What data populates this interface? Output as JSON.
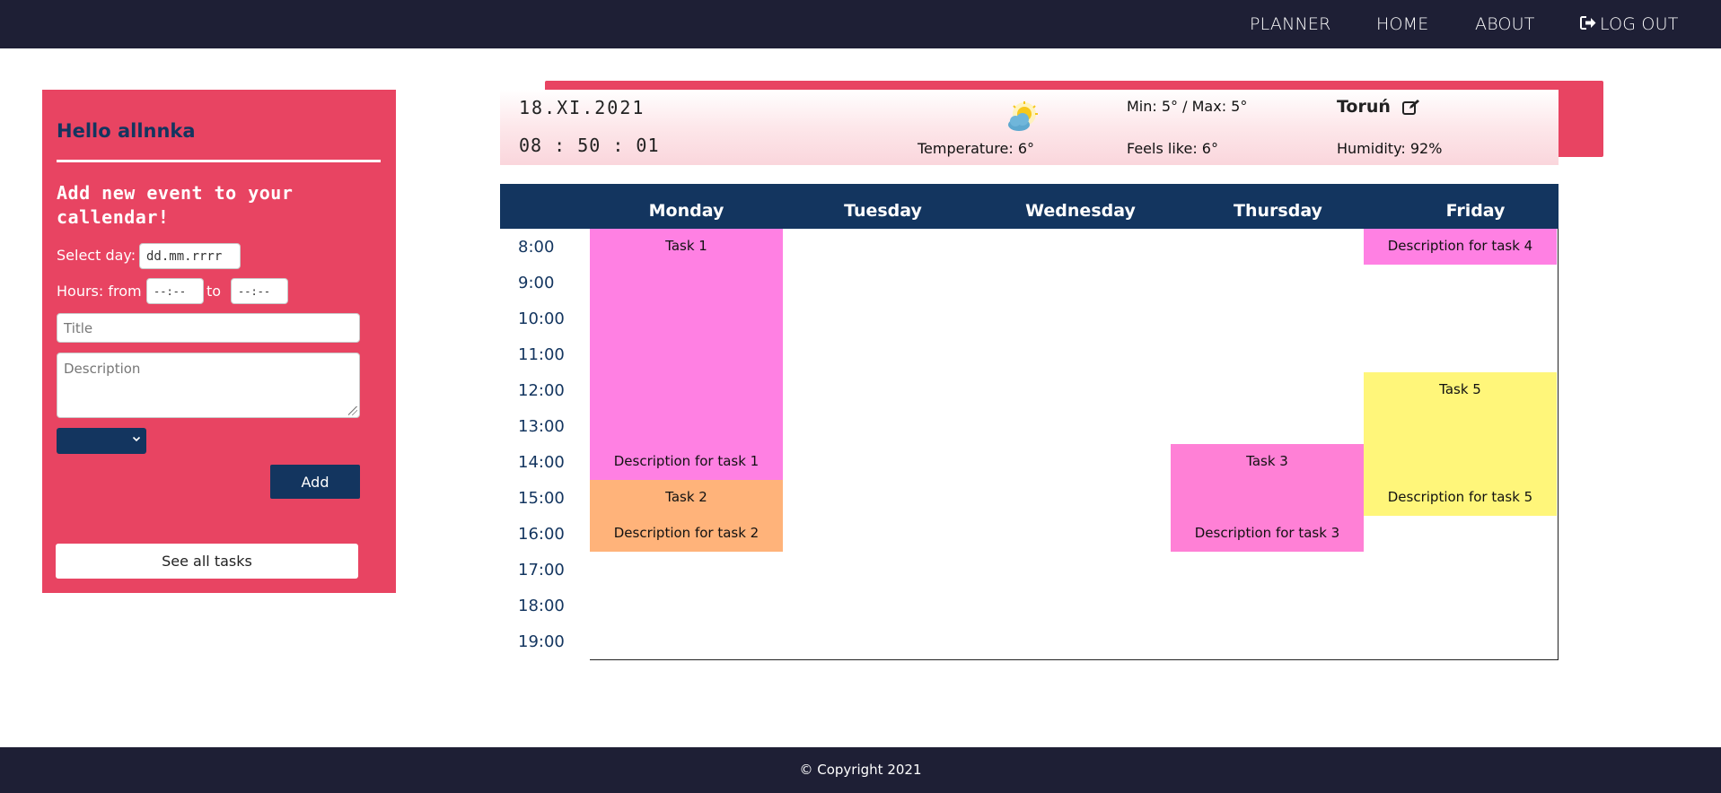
{
  "nav": {
    "planner": "PLANNER",
    "home": "HOME",
    "about": "ABOUT",
    "logout": "LOG OUT"
  },
  "sidebar": {
    "greeting": "Hello allnnka",
    "form_heading": "Add new event to your callendar!",
    "select_day_label": "Select day:",
    "date_placeholder": "dd.mm.rrrr",
    "hours_from_label": "Hours: from",
    "hours_to_label": "to",
    "time_from_placeholder": "--:--",
    "time_to_placeholder": "--:--",
    "title_placeholder": "Title",
    "description_placeholder": "Description",
    "category_value": "",
    "add_button": "Add",
    "see_all_button": "See all tasks"
  },
  "weather": {
    "date": "18.XI.2021",
    "time": "08 : 50 : 01",
    "icon": "partly-cloudy-icon",
    "temperature": "Temperature: 6°",
    "min_max": "Min: 5° / Max: 5°",
    "feels_like": "Feels like: 6°",
    "city": "Toruń",
    "humidity": "Humidity: 92%"
  },
  "calendar": {
    "days": [
      "Monday",
      "Tuesday",
      "Wednesday",
      "Thursday",
      "Friday"
    ],
    "hours": [
      "8:00",
      "9:00",
      "10:00",
      "11:00",
      "12:00",
      "13:00",
      "14:00",
      "15:00",
      "16:00",
      "17:00",
      "18:00",
      "19:00"
    ],
    "tasks": [
      {
        "title": "Task 1",
        "description": "Description for task 1",
        "day": "Monday",
        "start": "8:00",
        "end": "15:00",
        "color": "#ff80e3"
      },
      {
        "title": "Task 2",
        "description": "Description for task 2",
        "day": "Monday",
        "start": "15:00",
        "end": "17:00",
        "color": "#ffb37a"
      },
      {
        "title": "Task 3",
        "description": "Description for task 3",
        "day": "Thursday",
        "start": "14:00",
        "end": "17:00",
        "color": "#ff80d6"
      },
      {
        "title": "",
        "description": "Description for task 4",
        "day": "Friday",
        "start": "8:00",
        "end": "9:00",
        "color": "#ff80e3"
      },
      {
        "title": "Task 5",
        "description": "Description for task 5",
        "day": "Friday",
        "start": "12:00",
        "end": "16:00",
        "color": "#fff67a"
      }
    ]
  },
  "footer": {
    "copyright": "© Copyright 2021"
  },
  "colors": {
    "navy": "#13355f",
    "nav_dark": "#1e1f35",
    "accent_pink": "#e84462"
  }
}
